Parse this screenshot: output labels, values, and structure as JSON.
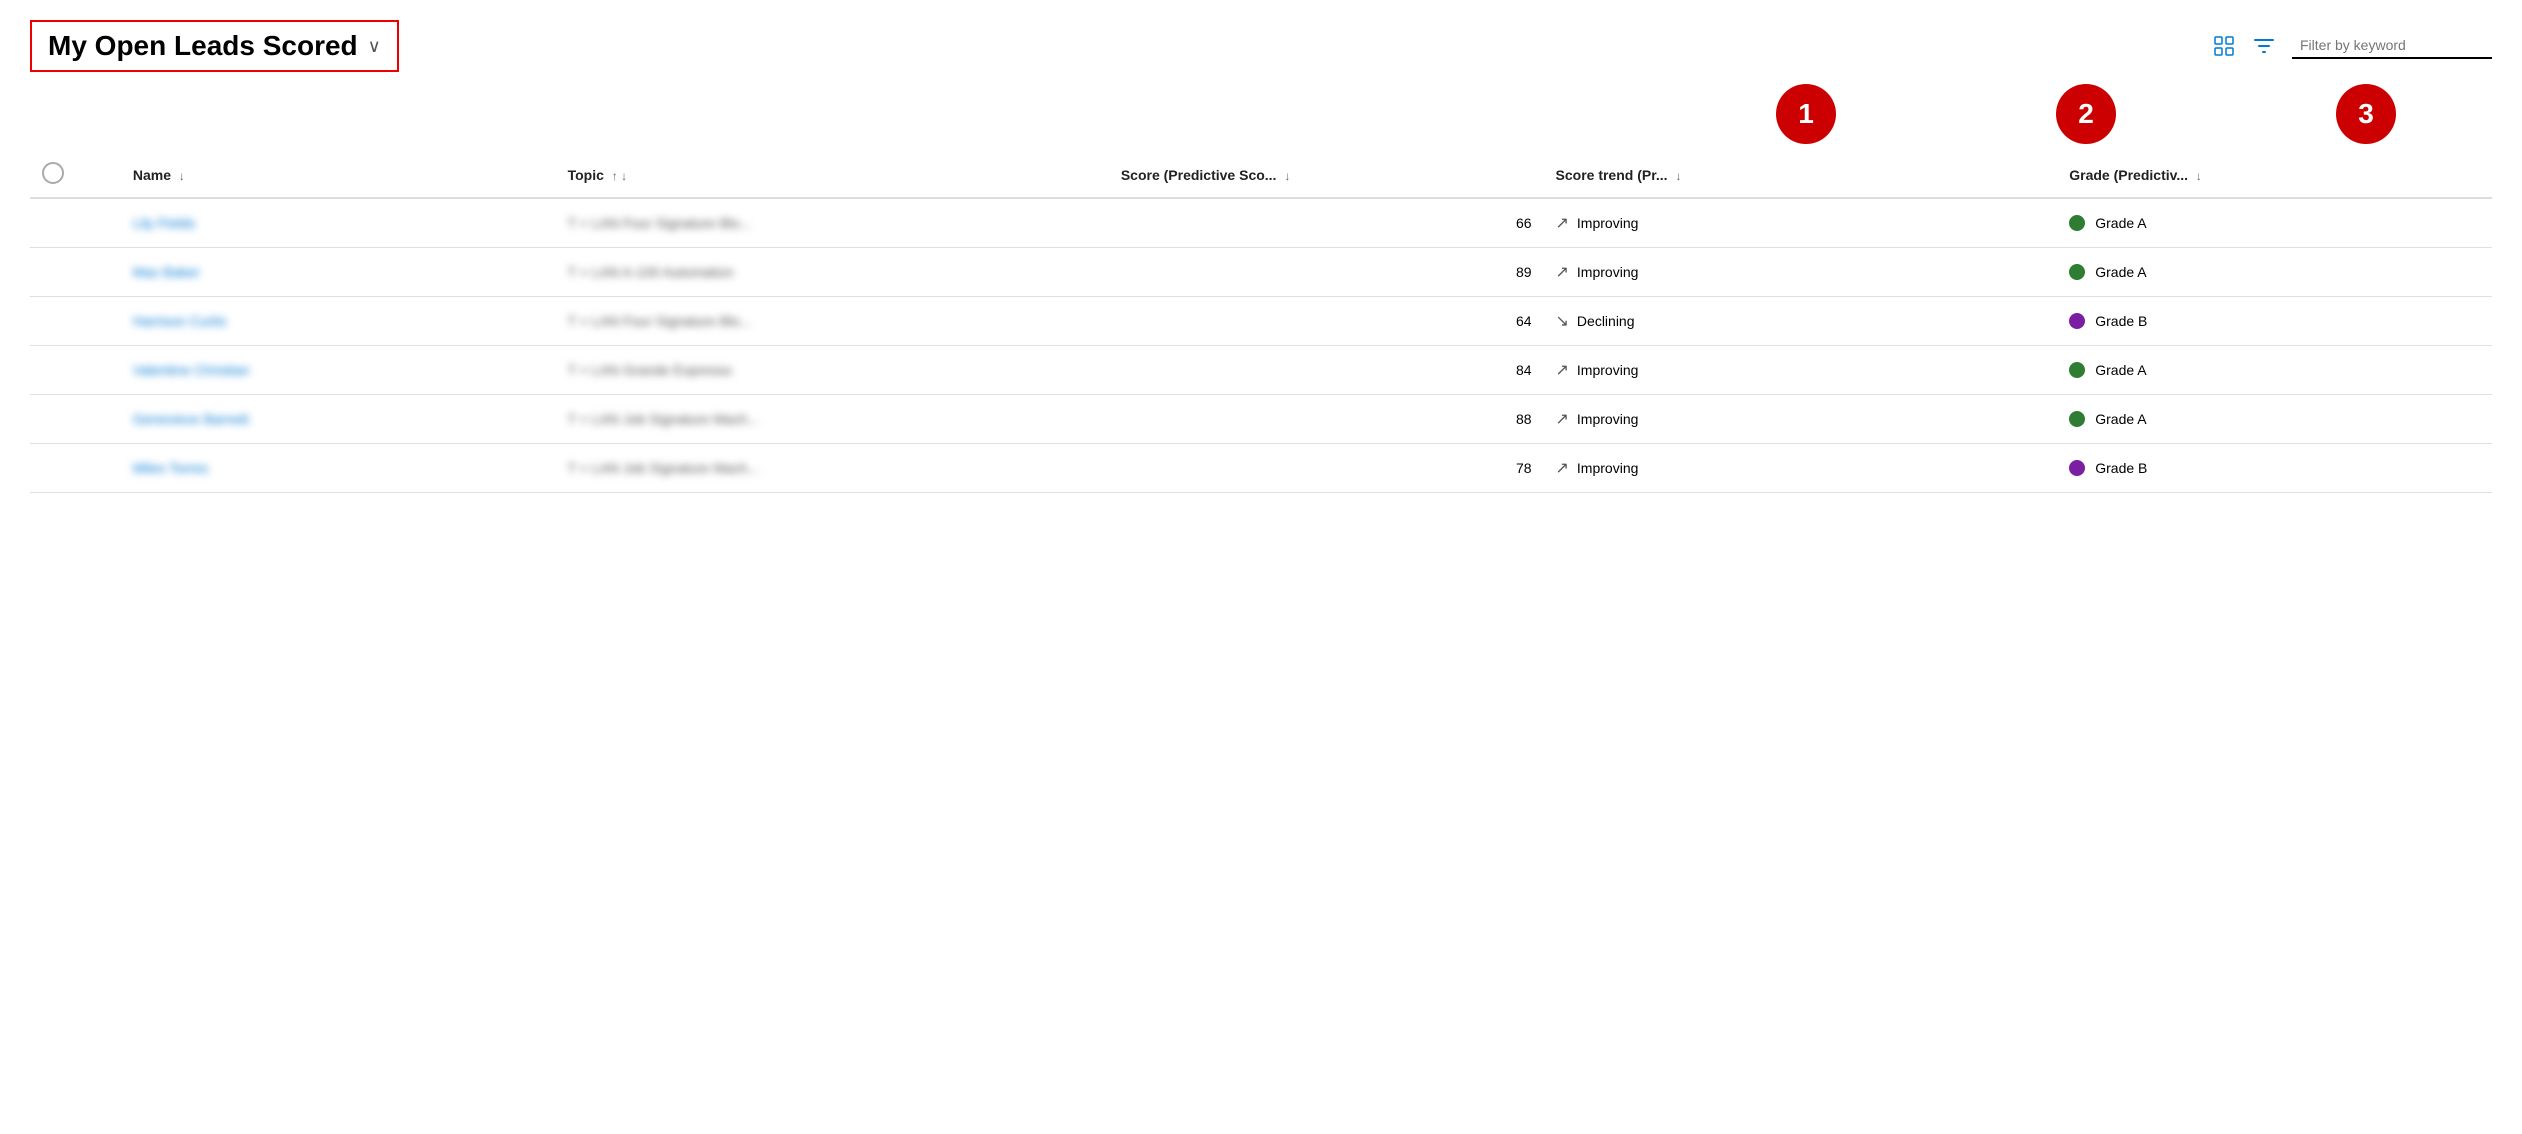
{
  "header": {
    "title": "My Open Leads Scored",
    "title_chevron": "∨",
    "filter_placeholder": "Filter by keyword"
  },
  "icons": {
    "column_settings": "⊞",
    "filter": "⛉"
  },
  "annotations": [
    "1",
    "2",
    "3"
  ],
  "table": {
    "columns": [
      {
        "key": "checkbox",
        "label": ""
      },
      {
        "key": "name",
        "label": "Name",
        "sort": "↓"
      },
      {
        "key": "topic",
        "label": "Topic",
        "sort": "↑ ↓"
      },
      {
        "key": "score",
        "label": "Score (Predictive Sco...",
        "sort": "↓"
      },
      {
        "key": "trend",
        "label": "Score trend (Pr...",
        "sort": "↓"
      },
      {
        "key": "grade",
        "label": "Grade (Predictiv...",
        "sort": "↓"
      }
    ],
    "rows": [
      {
        "name": "Lily Fields",
        "topic": "T + LAN Four Signature Blo...",
        "score": 66,
        "trend": "Improving",
        "trend_dir": "up",
        "grade": "Grade A",
        "grade_color": "green"
      },
      {
        "name": "Max Baker",
        "topic": "T + LAN A-100 Automation",
        "score": 89,
        "trend": "Improving",
        "trend_dir": "up",
        "grade": "Grade A",
        "grade_color": "green"
      },
      {
        "name": "Harrison Curtis",
        "topic": "T + LAN Four Signature Blo...",
        "score": 64,
        "trend": "Declining",
        "trend_dir": "down",
        "grade": "Grade B",
        "grade_color": "purple"
      },
      {
        "name": "Valentine Christian",
        "topic": "T + LAN Grande Expresso",
        "score": 84,
        "trend": "Improving",
        "trend_dir": "up",
        "grade": "Grade A",
        "grade_color": "green"
      },
      {
        "name": "Genevieve Barnett",
        "topic": "T + LAN Job Signature Mach...",
        "score": 88,
        "trend": "Improving",
        "trend_dir": "up",
        "grade": "Grade A",
        "grade_color": "green"
      },
      {
        "name": "Miles Torres",
        "topic": "T + LAN Job Signature Mach...",
        "score": 78,
        "trend": "Improving",
        "trend_dir": "up",
        "grade": "Grade B",
        "grade_color": "purple"
      }
    ]
  }
}
